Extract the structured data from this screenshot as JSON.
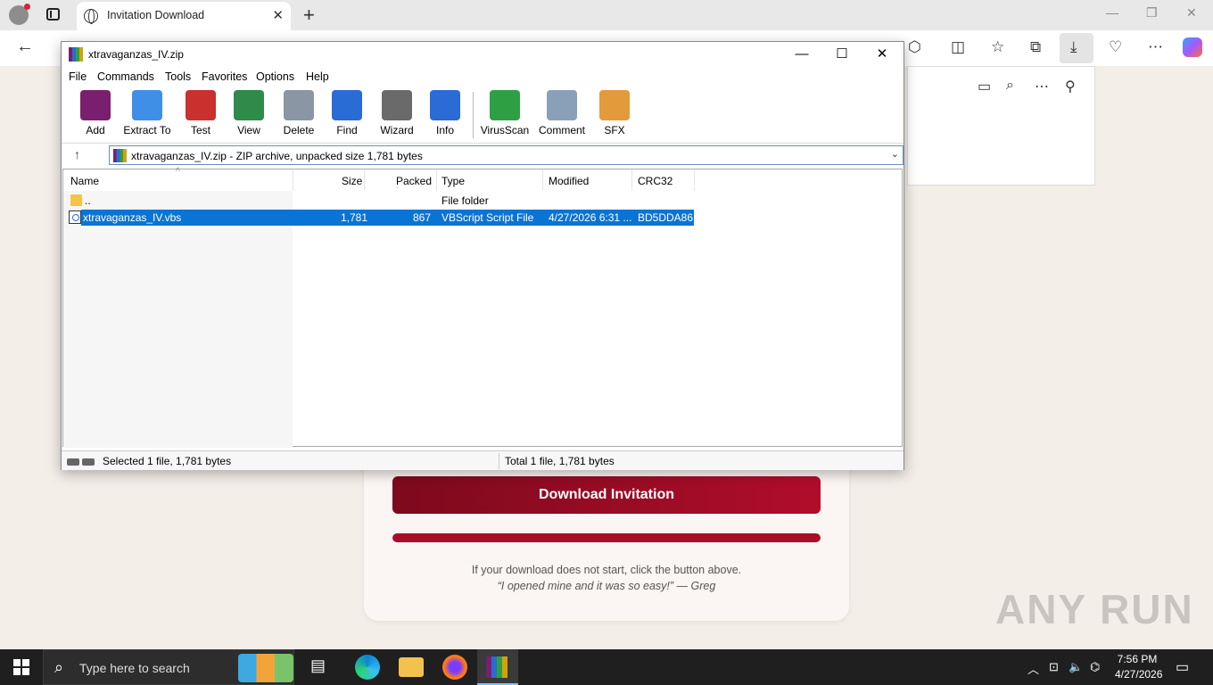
{
  "browser": {
    "tab_title": "Invitation Download",
    "new_tab_symbol": "+",
    "close_symbol": "✕"
  },
  "page": {
    "download_button": "Download Invitation",
    "progress_fraction": 1.0,
    "hint": "If your download does not start, click the button above.",
    "quote": "“I opened mine and it was so easy!” — Greg",
    "watermark": "ANY RUN"
  },
  "winrar": {
    "title": "xtravaganzas_IV.zip",
    "menu": [
      "File",
      "Commands",
      "Tools",
      "Favorites",
      "Options",
      "Help"
    ],
    "tools": [
      {
        "label": "Add",
        "icon": "add-archive-icon",
        "color": "#7a1f6e"
      },
      {
        "label": "Extract To",
        "icon": "extract-folder-icon",
        "color": "#3f8ee8"
      },
      {
        "label": "Test",
        "icon": "test-clipboard-icon",
        "color": "#c8312e"
      },
      {
        "label": "View",
        "icon": "view-book-icon",
        "color": "#2e8b4a"
      },
      {
        "label": "Delete",
        "icon": "trash-icon",
        "color": "#8a96a3"
      },
      {
        "label": "Find",
        "icon": "magnifier-icon",
        "color": "#2a6bd6"
      },
      {
        "label": "Wizard",
        "icon": "magic-wand-icon",
        "color": "#6a6a6a"
      },
      {
        "label": "Info",
        "icon": "info-icon",
        "color": "#2a6bd6"
      },
      {
        "label": "VirusScan",
        "icon": "virus-scan-icon",
        "color": "#2ea043"
      },
      {
        "label": "Comment",
        "icon": "comment-icon",
        "color": "#8aa0b8"
      },
      {
        "label": "SFX",
        "icon": "sfx-box-icon",
        "color": "#e39a3b"
      }
    ],
    "path": "xtravaganzas_IV.zip - ZIP archive, unpacked size 1,781 bytes",
    "columns": {
      "name": "Name",
      "size": "Size",
      "packed": "Packed",
      "type": "Type",
      "modified": "Modified",
      "crc": "CRC32"
    },
    "rows": [
      {
        "name": "..",
        "size": "",
        "packed": "",
        "type": "File folder",
        "modified": "",
        "crc": ""
      },
      {
        "name": "xtravaganzas_IV.vbs",
        "size": "1,781",
        "packed": "867",
        "type": "VBScript Script File",
        "modified": "4/27/2026 6:31 ...",
        "crc": "BD5DDA86"
      }
    ],
    "status_left": "Selected 1 file, 1,781 bytes",
    "status_right": "Total 1 file, 1,781 bytes"
  },
  "taskbar": {
    "search_placeholder": "Type here to search",
    "time": "7:56 PM",
    "date": "4/27/2026"
  }
}
